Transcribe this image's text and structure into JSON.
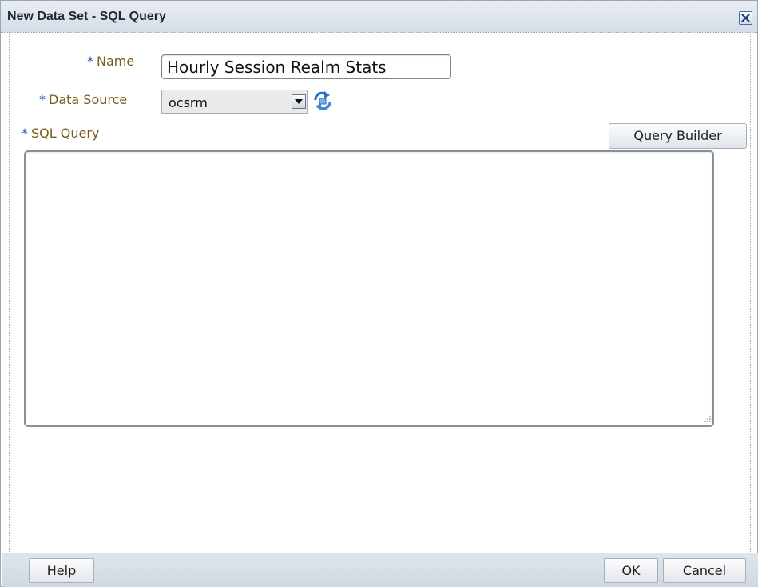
{
  "dialog": {
    "title": "New Data Set - SQL Query",
    "close_icon": "close-x-icon"
  },
  "form": {
    "required_marker": "*",
    "name_label": "Name",
    "name_value": "Hourly Session Realm Stats",
    "data_source_label": "Data Source",
    "data_source_value": "ocsrm",
    "refresh_icon": "refresh-icon",
    "sql_query_label": "SQL Query",
    "query_builder_label": "Query Builder",
    "sql_query_value": ""
  },
  "footer": {
    "help_label": "Help",
    "ok_label": "OK",
    "cancel_label": "Cancel"
  },
  "colors": {
    "label_text": "#7a5a17",
    "required_star": "#2a58b0",
    "titlebar": "#d6dde7",
    "footer": "#cfd8e2"
  }
}
